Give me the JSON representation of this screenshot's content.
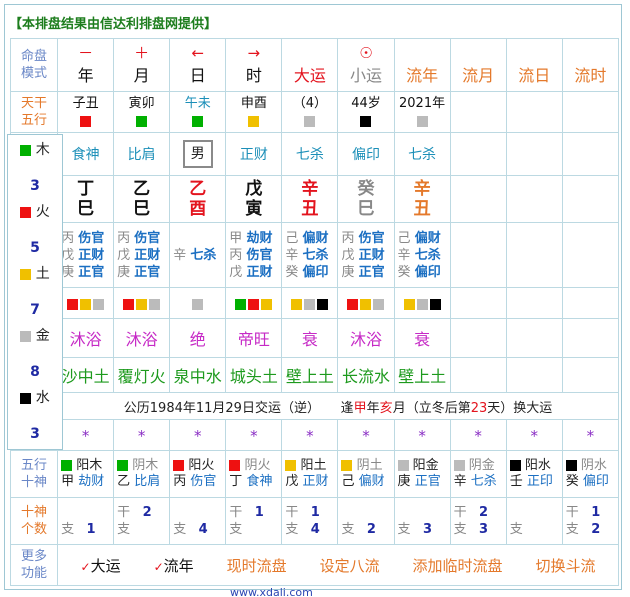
{
  "header": "【本排盘结果由信达利排盘网提供】",
  "colors": {
    "wood": "#00b000",
    "fire": "#ee1111",
    "earth": "#f0c000",
    "metal": "#bbbbbb",
    "water": "#000000"
  },
  "row_head": {
    "label": [
      "命盘",
      "模式"
    ],
    "cols": [
      {
        "sym": "－",
        "name": "年",
        "sym_color": "red",
        "name_color": "blk"
      },
      {
        "sym": "＋",
        "name": "月",
        "sym_color": "red",
        "name_color": "blk"
      },
      {
        "sym": "←",
        "name": "日",
        "sym_color": "red",
        "name_color": "blk"
      },
      {
        "sym": "→",
        "name": "时",
        "sym_color": "red",
        "name_color": "blk"
      },
      {
        "sym": "",
        "name": "大运",
        "sym_color": "red",
        "name_color": "red"
      },
      {
        "sym": "☉",
        "name": "小运",
        "sym_color": "red",
        "name_color": "gry"
      },
      {
        "sym": "",
        "name": "流年",
        "sym_color": "org",
        "name_color": "org"
      },
      {
        "sym": "",
        "name": "流月",
        "sym_color": "org",
        "name_color": "org"
      },
      {
        "sym": "",
        "name": "流日",
        "sym_color": "org",
        "name_color": "org"
      },
      {
        "sym": "",
        "name": "流时",
        "sym_color": "org",
        "name_color": "org"
      }
    ]
  },
  "row_nayin_label": [
    "天干",
    "五行"
  ],
  "row_top": [
    {
      "text": "子丑",
      "sq": "#ee1111",
      "tc": "blk"
    },
    {
      "text": "寅卯",
      "sq": "#00b000",
      "tc": "blk"
    },
    {
      "text": "午未",
      "sq": "#00b000",
      "tc": "tc"
    },
    {
      "text": "申酉",
      "sq": "#f0c000",
      "tc": "blk"
    },
    {
      "text": "（4）",
      "sq": "#bbbbbb",
      "tc": "blk"
    },
    {
      "text": "44岁",
      "sq": "#000000",
      "tc": "blk"
    },
    {
      "text": "2021年",
      "sq": "#bbbbbb",
      "tc": "blk"
    },
    {
      "text": "",
      "sq": "",
      "tc": "blk"
    },
    {
      "text": "",
      "sq": "",
      "tc": "blk"
    },
    {
      "text": "",
      "sq": "",
      "tc": "blk"
    }
  ],
  "shishen_top": [
    "食神",
    "比肩",
    "男",
    "正财",
    "七杀",
    "偏印",
    "七杀",
    "",
    "",
    ""
  ],
  "ganzhi": [
    {
      "g": "丁",
      "z": "巳",
      "c": "blk"
    },
    {
      "g": "乙",
      "z": "巳",
      "c": "blk"
    },
    {
      "g": "乙",
      "z": "酉",
      "c": "red"
    },
    {
      "g": "戊",
      "z": "寅",
      "c": "blk"
    },
    {
      "g": "辛",
      "z": "丑",
      "c": "red"
    },
    {
      "g": "癸",
      "z": "巳",
      "c": "gry"
    },
    {
      "g": "辛",
      "z": "丑",
      "c": "org"
    },
    {
      "g": "",
      "z": "",
      "c": "blk"
    },
    {
      "g": "",
      "z": "",
      "c": "blk"
    },
    {
      "g": "",
      "z": "",
      "c": "blk"
    }
  ],
  "canggan": [
    [
      [
        "丙",
        "伤官"
      ],
      [
        "戊",
        "正财"
      ],
      [
        "庚",
        "正官"
      ]
    ],
    [
      [
        "丙",
        "伤官"
      ],
      [
        "戊",
        "正财"
      ],
      [
        "庚",
        "正官"
      ]
    ],
    [
      [
        "辛",
        "七杀"
      ]
    ],
    [
      [
        "甲",
        "劫财"
      ],
      [
        "丙",
        "伤官"
      ],
      [
        "戊",
        "正财"
      ]
    ],
    [
      [
        "己",
        "偏财"
      ],
      [
        "辛",
        "七杀"
      ],
      [
        "癸",
        "偏印"
      ]
    ],
    [
      [
        "丙",
        "伤官"
      ],
      [
        "戊",
        "正财"
      ],
      [
        "庚",
        "正官"
      ]
    ],
    [
      [
        "己",
        "偏财"
      ],
      [
        "辛",
        "七杀"
      ],
      [
        "癸",
        "偏印"
      ]
    ],
    [],
    [],
    []
  ],
  "cang_squares": [
    [
      "#ee1111",
      "#f0c000",
      "#bbbbbb"
    ],
    [
      "#ee1111",
      "#f0c000",
      "#bbbbbb"
    ],
    [
      "#bbbbbb"
    ],
    [
      "#00b000",
      "#ee1111",
      "#f0c000"
    ],
    [
      "#f0c000",
      "#bbbbbb",
      "#000000"
    ],
    [
      "#ee1111",
      "#f0c000",
      "#bbbbbb"
    ],
    [
      "#f0c000",
      "#bbbbbb",
      "#000000"
    ],
    [],
    [],
    []
  ],
  "changsheng": [
    "沐浴",
    "沐浴",
    "绝",
    "帝旺",
    "衰",
    "沐浴",
    "衰",
    "",
    "",
    ""
  ],
  "nayin": [
    "沙中土",
    "覆灯火",
    "泉中水",
    "城头土",
    "壁上土",
    "长流水",
    "壁上土",
    "",
    "",
    ""
  ],
  "date_line": {
    "a": "公历1984年11月29日交运（逆）",
    "b": "逢",
    "c": "甲",
    "d": "年",
    "e": "亥",
    "f": "月（立冬后第",
    "g": "23",
    "h": "天）换大运"
  },
  "stars": [
    "*",
    "*",
    "*",
    "*",
    "*",
    "*",
    "*",
    "*",
    "*",
    "*"
  ],
  "wuxing_label": [
    "五行",
    "十神"
  ],
  "wuxing_rows": [
    {
      "sq": "#00b000",
      "a": "阳木",
      "g": "甲",
      "s": "劫财",
      "ac": "c1"
    },
    {
      "sq": "#00b000",
      "a": "阴木",
      "g": "乙",
      "s": "比肩",
      "ac": "c2"
    },
    {
      "sq": "#ee1111",
      "a": "阳火",
      "g": "丙",
      "s": "伤官",
      "ac": "c1"
    },
    {
      "sq": "#ee1111",
      "a": "阴火",
      "g": "丁",
      "s": "食神",
      "ac": "c2"
    },
    {
      "sq": "#f0c000",
      "a": "阳土",
      "g": "戊",
      "s": "正财",
      "ac": "c1"
    },
    {
      "sq": "#f0c000",
      "a": "阴土",
      "g": "己",
      "s": "偏财",
      "ac": "c2"
    },
    {
      "sq": "#bbbbbb",
      "a": "阳金",
      "g": "庚",
      "s": "正官",
      "ac": "c1"
    },
    {
      "sq": "#bbbbbb",
      "a": "阴金",
      "g": "辛",
      "s": "七杀",
      "ac": "c2"
    },
    {
      "sq": "#000000",
      "a": "阳水",
      "g": "壬",
      "s": "正印",
      "ac": "c1"
    },
    {
      "sq": "#000000",
      "a": "阴水",
      "g": "癸",
      "s": "偏印",
      "ac": "c2"
    }
  ],
  "count_label": [
    "十神",
    "个数"
  ],
  "counts": [
    {
      "gan": "",
      "ganv": "",
      "zhi": "1"
    },
    {
      "gan": "干",
      "ganv": "2",
      "zhi": ""
    },
    {
      "gan": "",
      "ganv": "",
      "zhi": "4"
    },
    {
      "gan": "干",
      "ganv": "1",
      "zhi": ""
    },
    {
      "gan": "干",
      "ganv": "1",
      "zhi": "4"
    },
    {
      "gan": "",
      "ganv": "",
      "zhi": "2"
    },
    {
      "gan": "",
      "ganv": "",
      "zhi": "3"
    },
    {
      "gan": "干",
      "ganv": "2",
      "zhi": "3"
    },
    {
      "gan": "",
      "ganv": "",
      "zhi": ""
    },
    {
      "gan": "干",
      "ganv": "1",
      "zhi": "2"
    }
  ],
  "zhi_label": "支",
  "func_label": [
    "更多",
    "功能"
  ],
  "functions": [
    "大运",
    "流年",
    "现时流盘",
    "设定八流",
    "添加临时流盘",
    "切换斗流"
  ],
  "sidebar": [
    {
      "name": "木",
      "n": "3",
      "color": "#00b000"
    },
    {
      "name": "火",
      "n": "5",
      "color": "#ee1111"
    },
    {
      "name": "土",
      "n": "7",
      "color": "#f0c000"
    },
    {
      "name": "金",
      "n": "8",
      "color": "#bbbbbb"
    },
    {
      "name": "水",
      "n": "3",
      "color": "#000000"
    }
  ],
  "footer_text": "www.xdali.com"
}
